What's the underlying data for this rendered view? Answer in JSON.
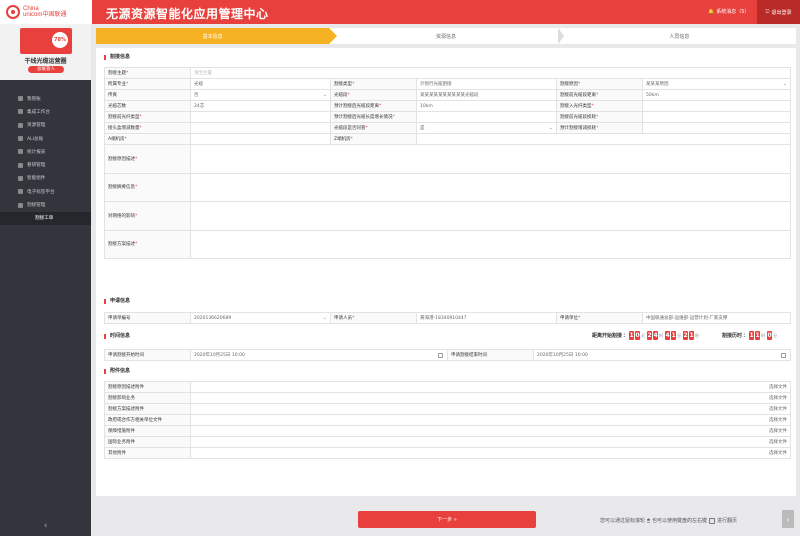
{
  "header": {
    "logo_text": "China\nunicom中国联通",
    "title": "无源资源智能化应用管理中心",
    "messages_label": "系统消息（5）",
    "logout_label": "退出登录"
  },
  "sidebar": {
    "progress": "78%",
    "user_name": "干线光缆运营圈",
    "user_role": "总账管人",
    "items": [
      {
        "label": "我管账"
      },
      {
        "label": "集成工作台"
      },
      {
        "label": "资源管理"
      },
      {
        "label": "ALI总账"
      },
      {
        "label": "统计报表"
      },
      {
        "label": "看研管理"
      },
      {
        "label": "智能组件"
      },
      {
        "label": "电子标签平台"
      },
      {
        "label": "割接管理"
      },
      {
        "label": "割接工单"
      }
    ],
    "collapse_icon": "‹"
  },
  "steps": [
    "基本信息",
    "资源信息",
    "人员信息"
  ],
  "sections": {
    "cut_info": "割接信息",
    "apply_info": "申请信息",
    "time_info": "时间信息",
    "attach_info": "附件信息"
  },
  "cut_info": {
    "topic_label": "割接主题",
    "topic_placeholder": "请至位置",
    "major_label": "所属专业",
    "major_value": "光缆",
    "type_label": "割接类型",
    "type_value": "计划行光缆割接",
    "reason_label": "割接原因",
    "reason_value": "某某某原因",
    "fax_label": "传真",
    "fax_value": "否",
    "segment_label": "光缆段",
    "segment_value": "某某某某某某某某某某光缆段",
    "pre_dist_label": "割接前光缆段距离",
    "pre_dist_value": "50km",
    "cores_label": "光缆芯数",
    "cores_value": "24芯",
    "pred_dist_label": "预计割接后光缆段距离",
    "pred_dist_value": "10km",
    "in_type_label": "割接入光纤类型",
    "pre_fiber_label": "割接前光纤类型",
    "pred_len_label": "预计割接后光缆长度增长情况",
    "pre_loss_label": "割接前光缆段损耗",
    "joint_label": "接头盒增减数量",
    "shared_label": "光缆段是否同管",
    "shared_value": "是",
    "pred_loss_label": "预计割接增减损耗",
    "a_room_label": "A端机房",
    "z_room_label": "Z端机房",
    "reason_desc_label": "割接原因描述",
    "summary_label": "割接摘要信息",
    "impact_label": "对网络的影响",
    "plan_label": "割接方案描述"
  },
  "apply": {
    "no_label": "申请单编号",
    "no_value": "2020136620689",
    "person_label": "申请人员",
    "person_value": "黄海港-18340910447",
    "unit_label": "申请单位",
    "unit_value": "中国联通总部-运维部-运营计划-厂家支撑"
  },
  "time": {
    "countdown_label": "距离开始割接",
    "countdown_days": [
      "1",
      "0"
    ],
    "countdown_hours": [
      "2",
      "4"
    ],
    "countdown_mins": [
      "4",
      "1"
    ],
    "countdown_secs": [
      "2",
      "1"
    ],
    "unit_d": "天",
    "unit_h": "时",
    "unit_m": "分",
    "unit_s": "秒",
    "elapsed_label": "割接历时",
    "elapsed_h": [
      "1",
      "1"
    ],
    "elapsed_m": [
      "0"
    ],
    "start_label": "申请割接开始时间",
    "start_value": "2020年10月25日 10:00",
    "end_label": "申请割接结束时间",
    "end_value": "2020年10月25日 10:00"
  },
  "attachments": {
    "select_label": "选择文件",
    "items": [
      "割接原因描述附件",
      "割接影响业务",
      "割接方案描述附件",
      "政府或合作方相关单位文件",
      "保障措施附件",
      "国际业务附件",
      "其他附件"
    ]
  },
  "footer": {
    "next_label": "下一步 »",
    "tip_left": "您可以通过鼠标滚轮",
    "tip_mid": "也可以使用键盘的左右键",
    "tip_right": "进行翻页"
  },
  "colors": {
    "accent": "#e8403c",
    "step_active": "#f5b223",
    "sidebar": "#33353d"
  }
}
